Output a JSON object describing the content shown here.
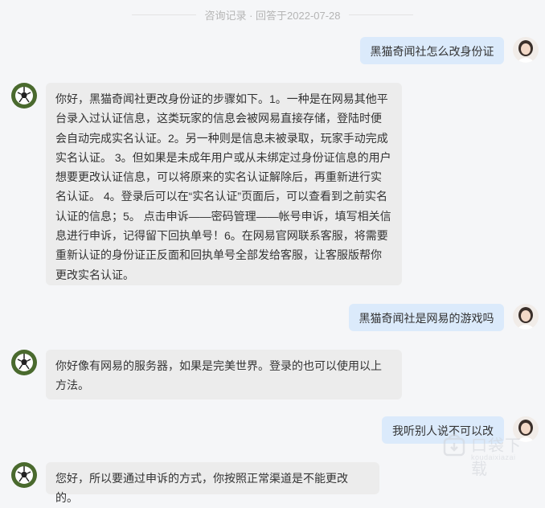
{
  "header": {
    "title": "咨询记录 · 回答于2022-07-28"
  },
  "messages": [
    {
      "role": "user",
      "text": "黑猫奇闻社怎么改身份证"
    },
    {
      "role": "bot",
      "text": "你好，黑猫奇闻社更改身份证的步骤如下。1。一种是在网易其他平台录入过认证信息，这类玩家的信息会被网易直接存储，登陆时便会自动完成实名认证。2。另一种则是信息未被录取，玩家手动完成实名认证。 3。但如果是未成年用户或从未绑定过身份证信息的用户想要更改认证信息，可以将原来的实名认证解除后，再重新进行实名认证。 4。登录后可以在“实名认证”页面后，可以查看到之前实名认证的信息；5。 点击申诉——密码管理——帐号申诉，填写相关信息进行申诉，记得留下回执单号！6。在网易官网联系客服，将需要重新认证的身份证正反面和回执单号全部发给客服，让客服版帮你更改实名认证。"
    },
    {
      "role": "user",
      "text": "黑猫奇闻社是网易的游戏吗"
    },
    {
      "role": "bot",
      "text": "你好像有网易的服务器，如果是完美世界。登录的也可以使用以上方法。"
    },
    {
      "role": "user",
      "text": "我听别人说不可以改"
    },
    {
      "role": "bot",
      "text": "您好，所以要通过申诉的方式，你按照正常渠道是不能更改的。"
    }
  ],
  "watermark": {
    "main": "口袋下载",
    "sub": "koudaixiazai"
  },
  "icons": {
    "user_avatar": "user-avatar-icon",
    "bot_avatar": "soccer-ball-icon"
  }
}
